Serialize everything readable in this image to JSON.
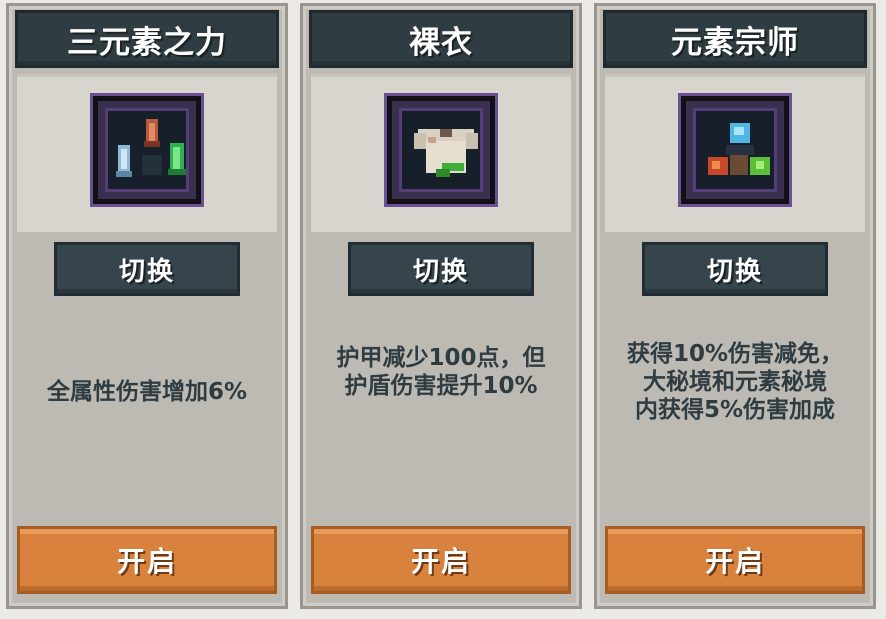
{
  "cards": [
    {
      "title": "三元素之力",
      "icon": "three-element-crystals-icon",
      "switch_label": "切换",
      "description_lines": [
        "全属性伤害增加6%"
      ],
      "enable_label": "开启"
    },
    {
      "title": "裸衣",
      "icon": "bare-shirt-icon",
      "switch_label": "切换",
      "description_lines": [
        "护甲减少100点，但",
        "护盾伤害提升10%"
      ],
      "enable_label": "开启"
    },
    {
      "title": "元素宗师",
      "icon": "element-master-gems-icon",
      "switch_label": "切换",
      "description_lines": [
        "获得10%伤害减免，",
        "大秘境和元素秘境",
        "内获得5%伤害加成"
      ],
      "enable_label": "开启"
    }
  ],
  "colors": {
    "title_bar": "#2f3c42",
    "panel": "#bdbab4",
    "enable_button": "#d8823d",
    "switch_button": "#36444c",
    "description_text": "#2f3c42"
  }
}
